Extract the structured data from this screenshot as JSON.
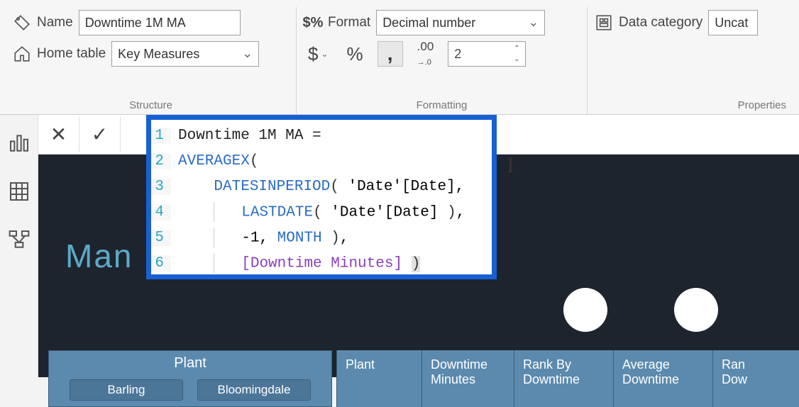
{
  "structure": {
    "name_label": "Name",
    "name_value": "Downtime 1M MA",
    "home_label": "Home table",
    "home_value": "Key Measures",
    "group_label": "Structure"
  },
  "formatting": {
    "format_label": "Format",
    "format_value": "Decimal number",
    "decimal_places": "2",
    "group_label": "Formatting"
  },
  "properties": {
    "category_label": "Data category",
    "category_value": "Uncat",
    "group_label": "Properties"
  },
  "dax": {
    "lines": [
      {
        "n": "1",
        "html": "<span class='ident'>Downtime 1M MA =</span>"
      },
      {
        "n": "2",
        "html": "<span class='kw'>AVERAGEX</span><span class='paren'>(</span>"
      },
      {
        "n": "3",
        "html": "    <span class='kw'>DATESINPERIOD</span><span class='paren'>(</span> <span class='tbl'>'Date'[Date]</span>,"
      },
      {
        "n": "4",
        "html": "    <span class='guide'></span>   <span class='kw'>LASTDATE</span><span class='paren'>(</span> <span class='tbl'>'Date'[Date]</span> <span class='paren'>)</span>,"
      },
      {
        "n": "5",
        "html": "    <span class='guide'></span>   -1, <span class='kw'>MONTH</span> <span class='paren'>)</span>,"
      },
      {
        "n": "6",
        "html": "    <span class='guide'></span>   <span class='meas'>[Downtime Minutes]</span> <span class='paren' style='background:#e2e2e2;'>)</span>"
      }
    ]
  },
  "report": {
    "title_fragment": "Man",
    "slicer": {
      "title": "Plant",
      "options": [
        "Barling",
        "Bloomingdale"
      ]
    },
    "table_headers": [
      "Plant",
      "Downtime Minutes",
      "Rank By Downtime",
      "Average Downtime",
      "Ran Dow"
    ]
  }
}
